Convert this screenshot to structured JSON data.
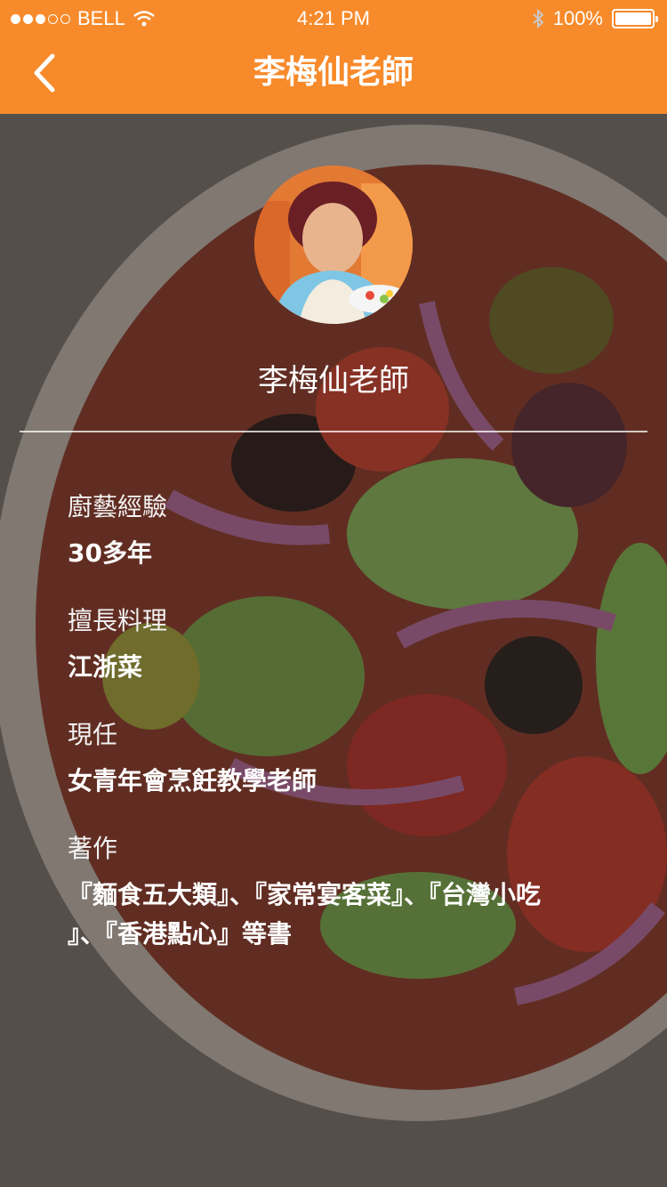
{
  "status_bar": {
    "carrier": "BELL",
    "time": "4:21 PM",
    "battery": "100%"
  },
  "nav": {
    "title": "李梅仙老師",
    "back_icon": "chevron-left-icon"
  },
  "profile": {
    "name": "李梅仙老師",
    "avatar_icon": "teacher-avatar"
  },
  "info": [
    {
      "label": "廚藝經驗",
      "value": "30多年"
    },
    {
      "label": "擅長料理",
      "value": "江浙菜"
    },
    {
      "label": "現任",
      "value": "女青年會烹飪教學老師"
    },
    {
      "label": "著作",
      "value_lines": [
        "『麵食五大類』、『家常宴客菜』、『台灣小吃",
        "』、『香港點心』等書"
      ]
    }
  ],
  "colors": {
    "accent": "#f78a2a",
    "text": "#ffffff"
  }
}
